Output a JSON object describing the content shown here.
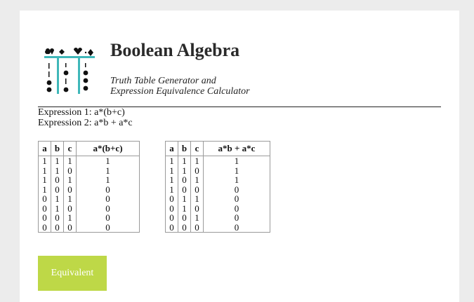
{
  "header": {
    "title": "Boolean Algebra",
    "subtitle_line1": "Truth Table Generator and",
    "subtitle_line2": "Expression Equivalence Calculator"
  },
  "expressions": {
    "expr1": "Expression 1: a*(b+c)",
    "expr2": "Expression 2: a*b + a*c"
  },
  "tables": [
    {
      "headers": [
        "a",
        "b",
        "c",
        "a*(b+c)"
      ],
      "rows": [
        [
          "1",
          "1",
          "1",
          "1"
        ],
        [
          "1",
          "1",
          "0",
          "1"
        ],
        [
          "1",
          "0",
          "1",
          "1"
        ],
        [
          "1",
          "0",
          "0",
          "0"
        ],
        [
          "0",
          "1",
          "1",
          "0"
        ],
        [
          "0",
          "1",
          "0",
          "0"
        ],
        [
          "0",
          "0",
          "1",
          "0"
        ],
        [
          "0",
          "0",
          "0",
          "0"
        ]
      ]
    },
    {
      "headers": [
        "a",
        "b",
        "c",
        "a*b + a*c"
      ],
      "rows": [
        [
          "1",
          "1",
          "1",
          "1"
        ],
        [
          "1",
          "1",
          "0",
          "1"
        ],
        [
          "1",
          "0",
          "1",
          "1"
        ],
        [
          "1",
          "0",
          "0",
          "0"
        ],
        [
          "0",
          "1",
          "1",
          "0"
        ],
        [
          "0",
          "1",
          "0",
          "0"
        ],
        [
          "0",
          "0",
          "1",
          "0"
        ],
        [
          "0",
          "0",
          "0",
          "0"
        ]
      ]
    }
  ],
  "result_button": {
    "label": "Equivalent",
    "color": "#bed847"
  },
  "colors": {
    "logo_teal": "#3fb7b9",
    "background": "#ececec",
    "card": "#ffffff"
  }
}
